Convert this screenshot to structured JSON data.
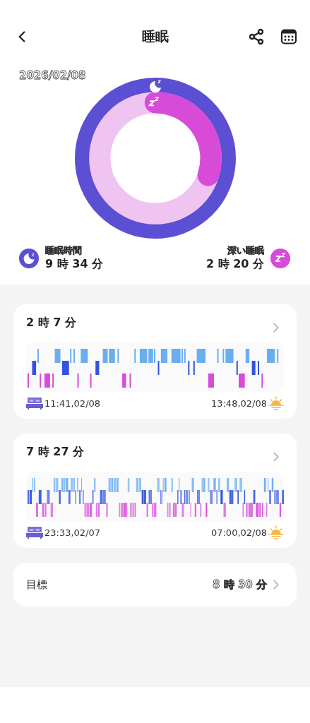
{
  "header": {
    "title": "睡眠"
  },
  "date": "2026/02/08",
  "summary": [
    {
      "kind": "total",
      "label": "睡眠時間",
      "value": "9 時 34 分"
    },
    {
      "kind": "deep",
      "label": "深い睡眠",
      "value": "2 時 20 分"
    }
  ],
  "sessions": [
    {
      "duration": "2 時 7 分",
      "start": "11:41,02/08",
      "end": "13:48,02/08"
    },
    {
      "duration": "7 時 27 分",
      "start": "23:33,02/07",
      "end": "07:00,02/08"
    }
  ],
  "goal": {
    "label": "目標",
    "value": "8 時 30 分"
  }
}
